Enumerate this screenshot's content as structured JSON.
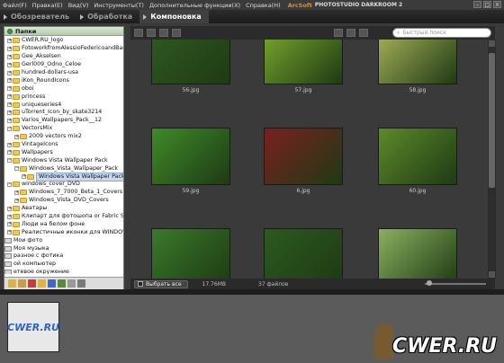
{
  "menu": {
    "items": [
      "Файл(F)",
      "Правка(E)",
      "Вид(V)",
      "Инструменты(T)",
      "Дополнительные функции(X)",
      "Справка(H)"
    ],
    "brand": "ArcSoft",
    "app_title": "PHOTOSTUDIO DARKROOM 2"
  },
  "tabs": [
    {
      "label": "Обозреватель",
      "active": false
    },
    {
      "label": "Обработка",
      "active": false
    },
    {
      "label": "Компоновка",
      "active": true
    }
  ],
  "left_panel": {
    "title": "Папки",
    "tree": [
      {
        "label": "CWER.RU_logo",
        "type": "folder",
        "indent": 0
      },
      {
        "label": "FotoworkfromAlessioFedericoandBarba",
        "type": "folder",
        "indent": 0
      },
      {
        "label": "Gee_Akselsen",
        "type": "folder",
        "indent": 0
      },
      {
        "label": "Gerl009_Odno_Celoe",
        "type": "folder",
        "indent": 0
      },
      {
        "label": "hundred-dollars-usa",
        "type": "folder",
        "indent": 0
      },
      {
        "label": "iKon_RoundIcons",
        "type": "folder",
        "indent": 0
      },
      {
        "label": "oboi",
        "type": "folder",
        "indent": 0
      },
      {
        "label": "princess",
        "type": "folder",
        "indent": 0
      },
      {
        "label": "uniqueseries4",
        "type": "folder",
        "indent": 0
      },
      {
        "label": "uTorrent_Icon_by_skate3214",
        "type": "folder",
        "indent": 0
      },
      {
        "label": "Varios_Wallpapers_Pack__12",
        "type": "folder",
        "indent": 0
      },
      {
        "label": "VectorsMix",
        "type": "folder",
        "indent": 0,
        "expanded": true
      },
      {
        "label": "2009 vectors mix2",
        "type": "folder",
        "indent": 1
      },
      {
        "label": "VintageIcons",
        "type": "folder",
        "indent": 0
      },
      {
        "label": "Wallpapers",
        "type": "folder",
        "indent": 0
      },
      {
        "label": "Windows Vista Wallpaper Pack",
        "type": "folder",
        "indent": 0,
        "expanded": true
      },
      {
        "label": "Windows_Vista_Wallpaper_Pack",
        "type": "folder",
        "indent": 1,
        "expanded": true
      },
      {
        "label": "Windows Vista Wallpaper Pack",
        "type": "folder",
        "indent": 2,
        "selected": true
      },
      {
        "label": "windows_cover_DVD",
        "type": "folder",
        "indent": 0,
        "expanded": true
      },
      {
        "label": "Windows_7_7000_Beta_1_Covers",
        "type": "folder",
        "indent": 1
      },
      {
        "label": "Windows_Vista_DVD_Covers",
        "type": "folder",
        "indent": 1
      },
      {
        "label": "Аватары",
        "type": "folder",
        "indent": 0
      },
      {
        "label": "Клипарт для фотошопа or Fabric Stu",
        "type": "folder",
        "indent": 0
      },
      {
        "label": "Люди на белом фоне",
        "type": "folder",
        "indent": 0
      },
      {
        "label": "Реалистичные иконки для WINDOWS",
        "type": "folder",
        "indent": 0
      },
      {
        "label": "Мои фото",
        "type": "drive",
        "indent": -1
      },
      {
        "label": "Моя музыка",
        "type": "drive",
        "indent": -1
      },
      {
        "label": "разное с фотика",
        "type": "drive",
        "indent": -1
      },
      {
        "label": "ой компьютер",
        "type": "drive",
        "indent": -2
      },
      {
        "label": "етевое окружение",
        "type": "drive",
        "indent": -2
      },
      {
        "label": "Архайтс",
        "type": "drive",
        "indent": -2
      }
    ]
  },
  "search": {
    "placeholder": "Быстрый поиск"
  },
  "thumbnails": [
    {
      "name": "56.jpg",
      "color": "#2f5a22"
    },
    {
      "name": "57.jpg",
      "color": "#7aa82e"
    },
    {
      "name": "58.jpg",
      "color": "#a9b45a"
    },
    {
      "name": "59.jpg",
      "color": "#3f8a2a"
    },
    {
      "name": "6.jpg",
      "color": "#7a2020"
    },
    {
      "name": "60.jpg",
      "color": "#5c8a2a"
    },
    {
      "name": "",
      "color": "#3a7a2a"
    },
    {
      "name": "",
      "color": "#2c5a1e"
    },
    {
      "name": "",
      "color": "#8ab060"
    }
  ],
  "status": {
    "select_all": "Выбрать все",
    "size": "17.76MB",
    "count": "37 файлов"
  },
  "filmstrip": {
    "logo": "CWER.RU"
  },
  "watermark": "CWER.RU"
}
